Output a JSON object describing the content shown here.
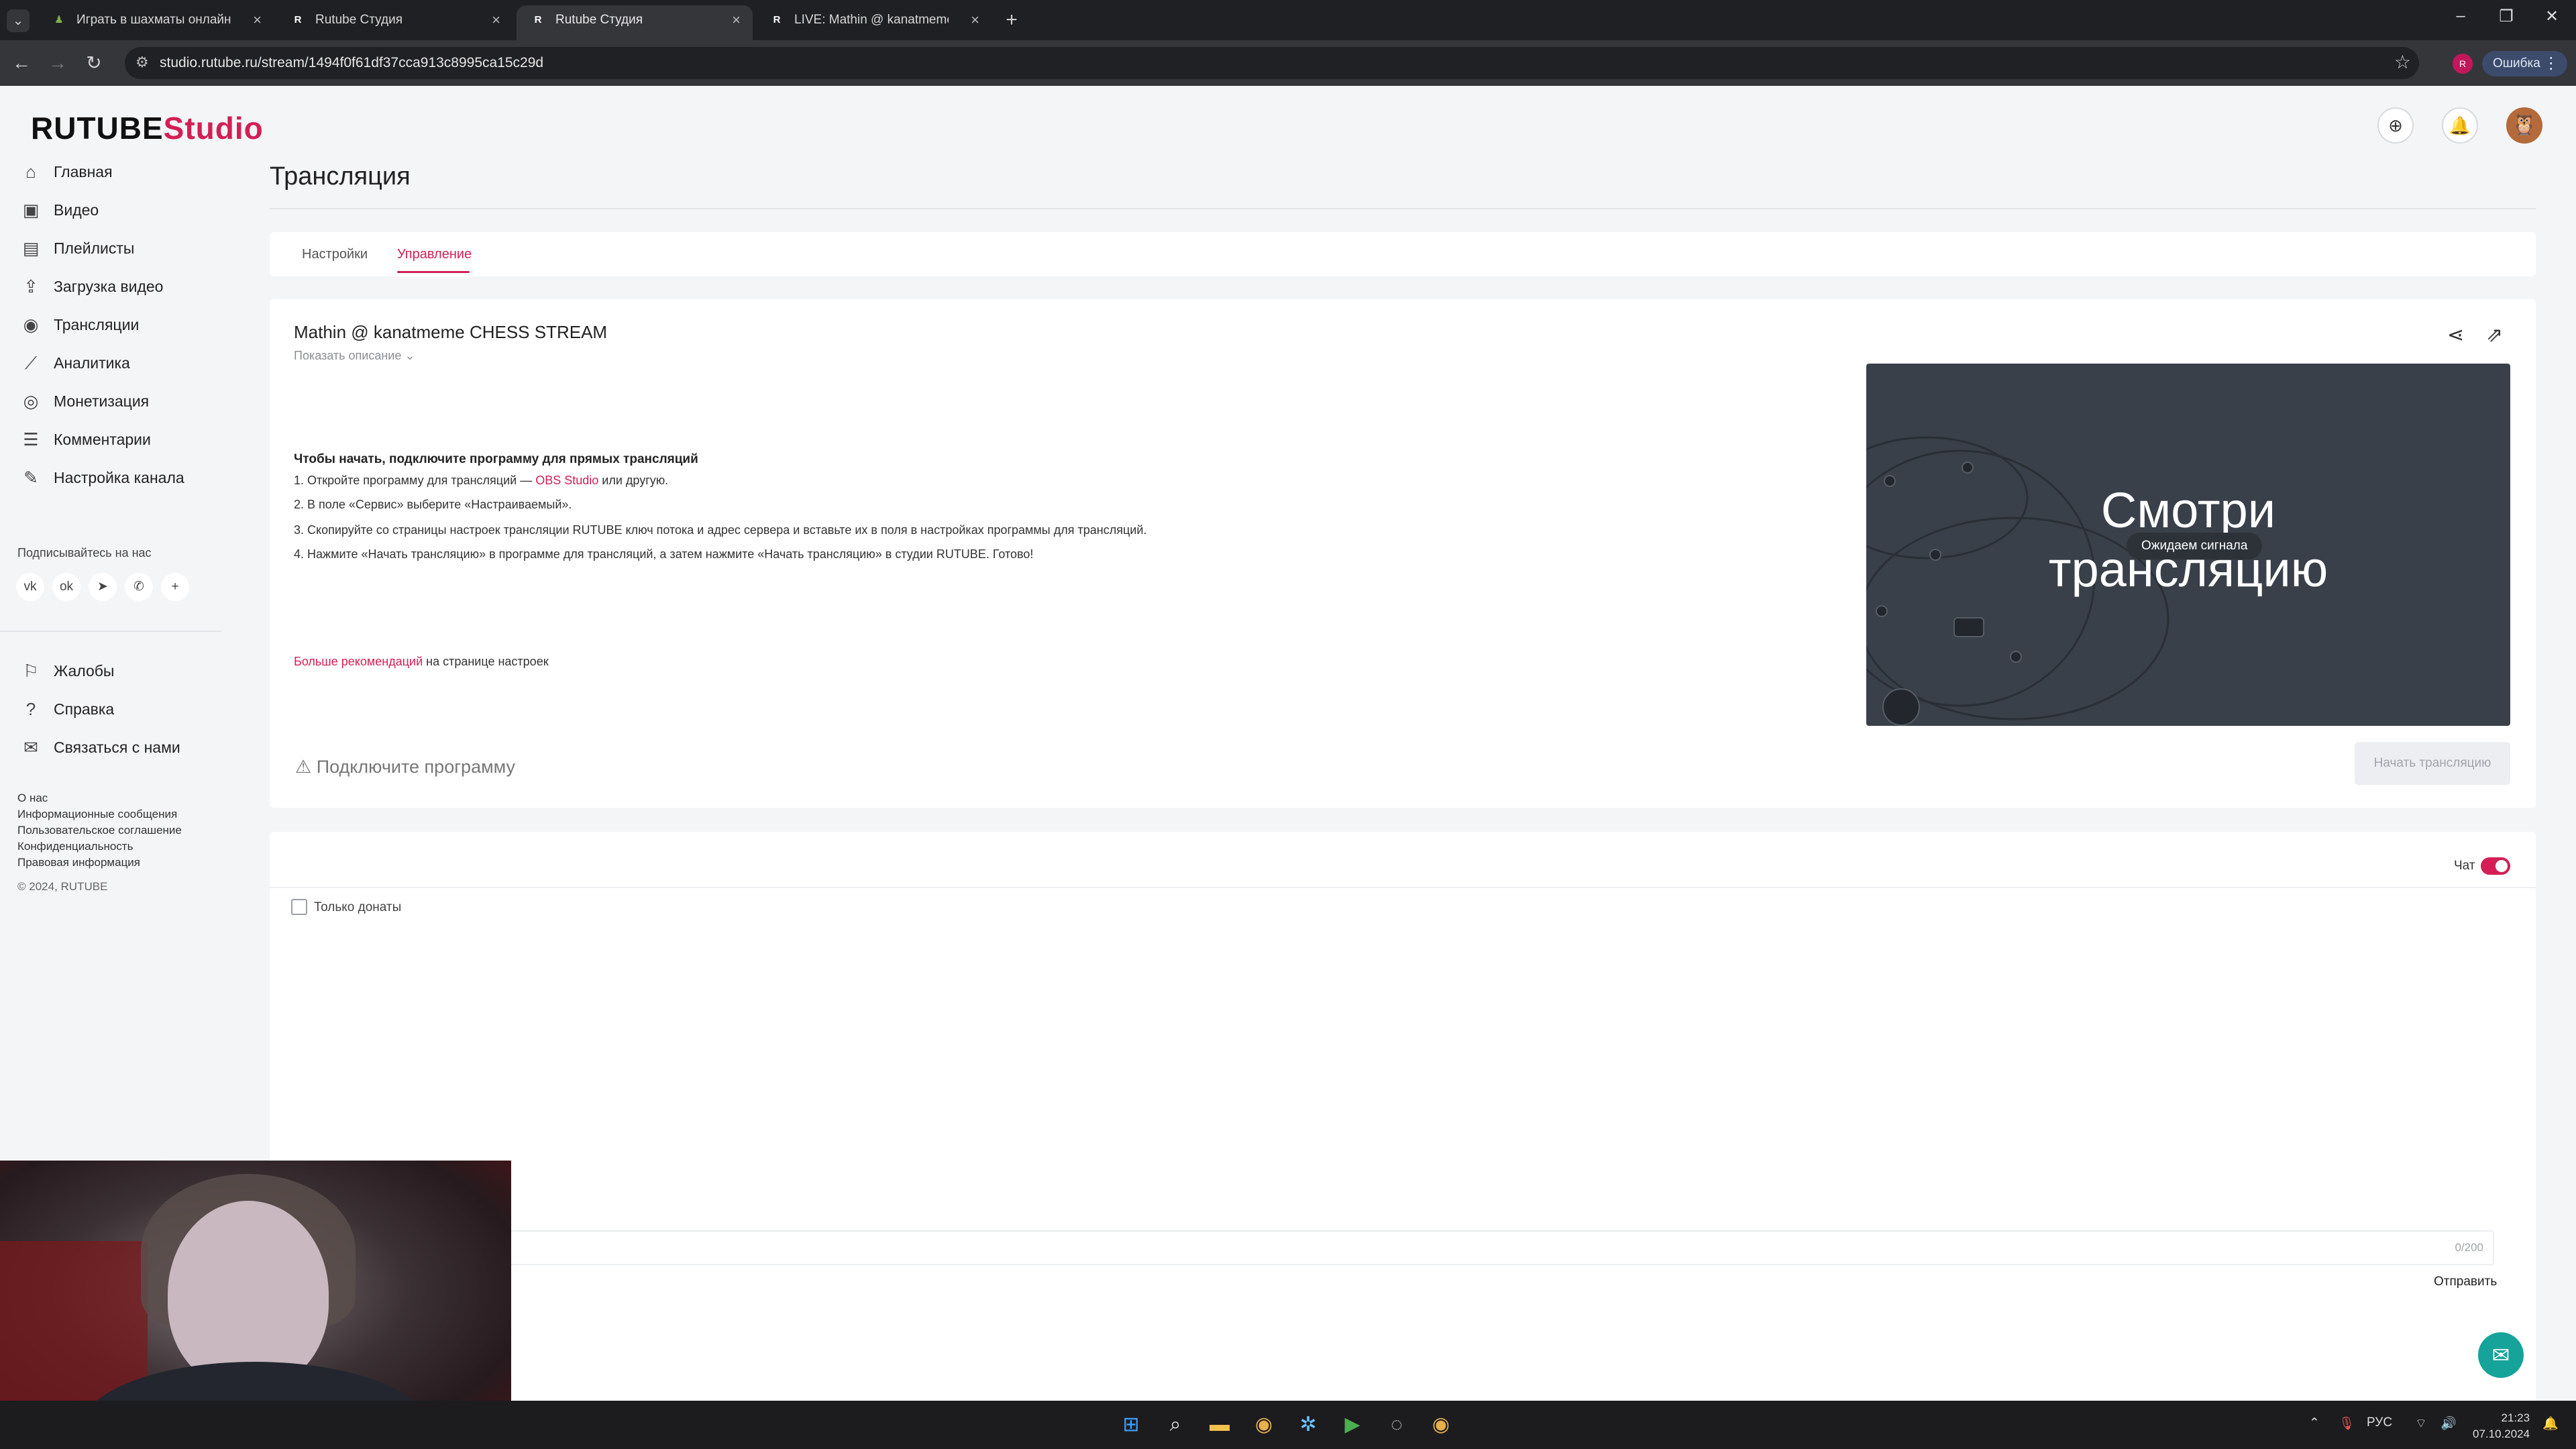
{
  "browser": {
    "tabs": [
      {
        "title": "Играть в шахматы онлайн БЕС"
      },
      {
        "title": "Rutube Студия"
      },
      {
        "title": "Rutube Студия"
      },
      {
        "title": "LIVE: Mathin @ kanatmeme CH"
      }
    ],
    "url": "studio.rutube.ru/stream/1494f0f61df37cca913c8995ca15c29d",
    "profile_badge": "R",
    "error_label": "Ошибка"
  },
  "header": {
    "logo_main": "RUTUBE",
    "logo_studio": "Studio"
  },
  "sidebar": {
    "items": [
      {
        "label": "Главная",
        "icon": "home-icon"
      },
      {
        "label": "Видео",
        "icon": "video-icon"
      },
      {
        "label": "Плейлисты",
        "icon": "playlist-icon"
      },
      {
        "label": "Загрузка видео",
        "icon": "upload-icon"
      },
      {
        "label": "Трансляции",
        "icon": "broadcast-icon"
      },
      {
        "label": "Аналитика",
        "icon": "analytics-icon"
      },
      {
        "label": "Монетизация",
        "icon": "monetization-icon"
      },
      {
        "label": "Комментарии",
        "icon": "comments-icon"
      },
      {
        "label": "Настройка канала",
        "icon": "channel-settings-icon"
      }
    ],
    "follow_title": "Подписывайтесь на нас",
    "social": [
      "vk",
      "ok",
      "telegram",
      "viber",
      "more"
    ],
    "bottom_items": [
      {
        "label": "Жалобы",
        "icon": "complaints-icon"
      },
      {
        "label": "Справка",
        "icon": "help-icon"
      },
      {
        "label": "Связаться с нами",
        "icon": "contact-icon"
      }
    ],
    "footer_links": [
      "О нас",
      "Информационные сообщения",
      "Пользовательское соглашение",
      "Конфиденциальность",
      "Правовая информация"
    ],
    "copyright": "© 2024, RUTUBE"
  },
  "main": {
    "page_title": "Трансляция",
    "tabs": [
      {
        "label": "Настройки",
        "active": false
      },
      {
        "label": "Управление",
        "active": true
      }
    ],
    "stream": {
      "title": "Mathin @ kanatmeme CHESS STREAM",
      "show_description": "Показать описание",
      "instructions_heading": "Чтобы начать, подключите программу для прямых трансляций",
      "step1_pre": "1. Откройте программу для трансляций — ",
      "step1_link": "OBS Studio",
      "step1_post": " или другую.",
      "step2": "2. В поле «Сервис» выберите «Настраиваемый».",
      "step3": "3. Скопируйте со страницы настроек трансляции RUTUBE ключ потока и адрес сервера и вставьте их в поля в настройках программы для трансляций.",
      "step4": "4. Нажмите «Начать трансляцию» в программе для трансляций, а затем нажмите «Начать трансляцию» в студии RUTUBE. Готово!",
      "more_link": "Больше рекомендаций",
      "more_post": " на странице настроек",
      "preview_line1": "Смотри",
      "preview_line2": "трансляцию",
      "preview_status": "Ожидаем сигнала",
      "warning": "Подключите программу",
      "start_button": "Начать трансляцию"
    },
    "chat": {
      "label": "Чат",
      "enabled": true,
      "donations_only_label": "Только донаты",
      "donations_only_checked": false,
      "char_count": "0/200",
      "send_label": "Отправить"
    }
  },
  "taskbar": {
    "lang": "РУС",
    "time": "21:23",
    "date": "07.10.2024"
  },
  "colors": {
    "accent": "#d31f55",
    "page_bg": "#f4f5f7",
    "preview_bg": "#3a4049",
    "support": "#16a39a"
  }
}
